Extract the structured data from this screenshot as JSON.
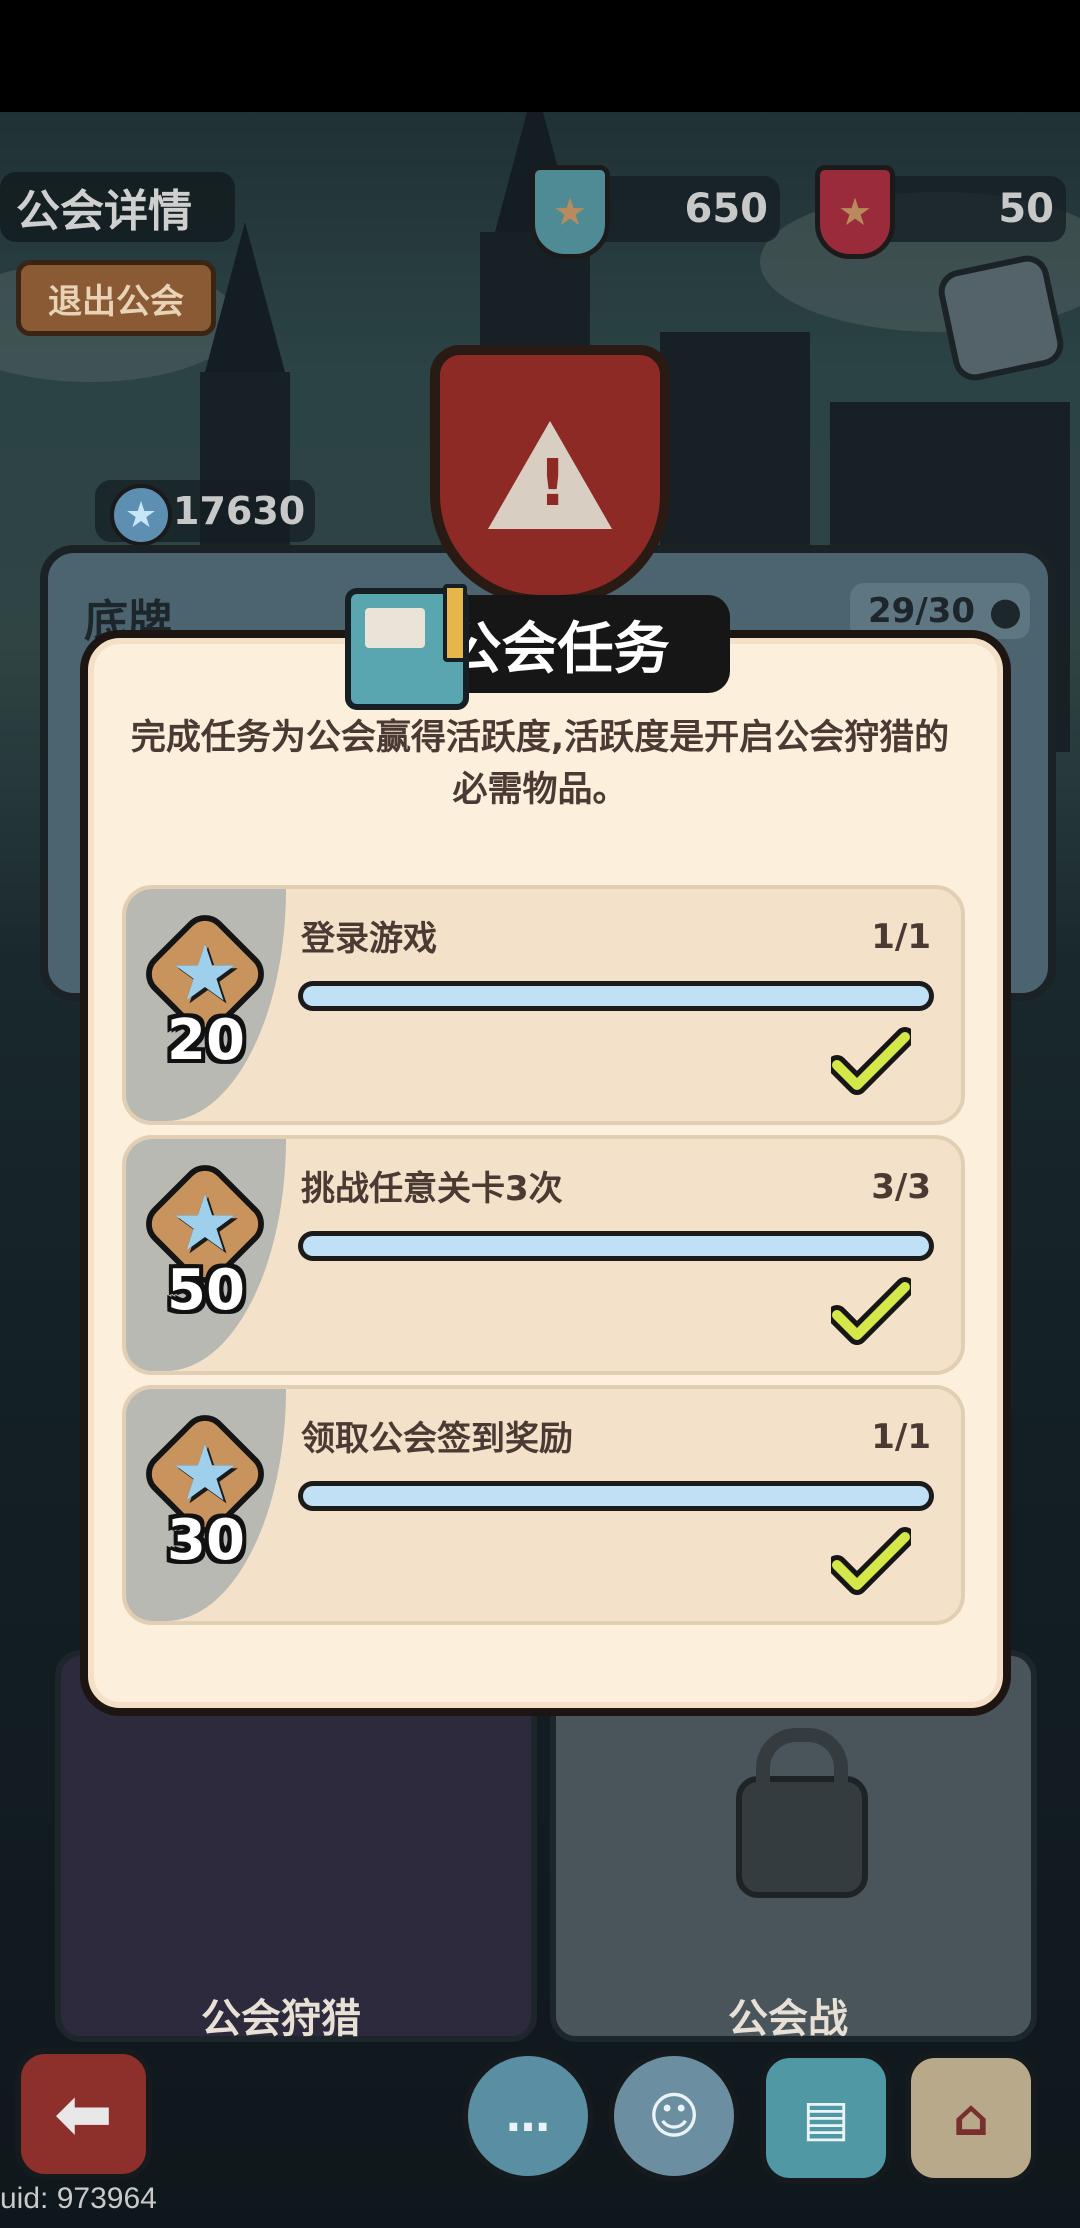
{
  "header": {
    "guild_detail_title": "公会详情",
    "leave_guild_button": "退出公会",
    "currency_blue": "650",
    "currency_red": "50",
    "guild_score": "17630",
    "guild_name": "底牌",
    "member_count": "29/30"
  },
  "dialog": {
    "title": "公会任务",
    "description": "完成任务为公会赢得活跃度,活跃度是开启公会狩猎的必需物品。",
    "tasks": [
      {
        "name": "登录游戏",
        "progress": "1/1",
        "reward": "20",
        "completion": 1.0,
        "completed": true
      },
      {
        "name": "挑战任意关卡3次",
        "progress": "3/3",
        "reward": "50",
        "completion": 1.0,
        "completed": true
      },
      {
        "name": "领取公会签到奖励",
        "progress": "1/1",
        "reward": "30",
        "completion": 1.0,
        "completed": true
      }
    ]
  },
  "cards": {
    "left_label": "公会狩猎",
    "right_label": "公会战"
  },
  "footer": {
    "uid": "uid: 973964"
  },
  "colors": {
    "accent_red": "#8e2a25",
    "progress_fill": "#bfe0f5",
    "check_green": "#d4e84a",
    "dialog_bg": "#fcefdc"
  },
  "icons": [
    "star-icon",
    "warning-icon",
    "book-icon",
    "check-icon",
    "lock-icon",
    "chat-icon",
    "friends-icon",
    "shop-icon",
    "back-arrow-icon",
    "person-icon"
  ]
}
